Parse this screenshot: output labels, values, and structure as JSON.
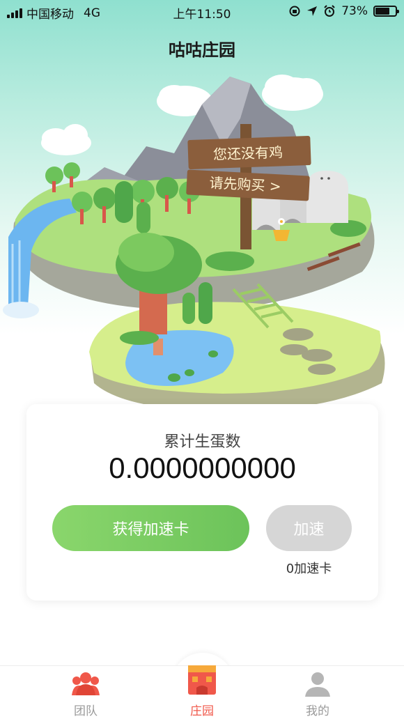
{
  "status_bar": {
    "carrier": "中国移动",
    "network": "4G",
    "time": "上午11:50",
    "battery": "73%",
    "battery_level": 0.73
  },
  "page": {
    "title": "咕咕庄园"
  },
  "scene": {
    "sign_line1": "您还没有鸡",
    "sign_line2": "请先购买 >"
  },
  "egg_card": {
    "label": "累计生蛋数",
    "value": "0.0000000000",
    "get_card_button": "获得加速卡",
    "speed_button": "加速",
    "speed_card_count": "0加速卡"
  },
  "tab_bar": {
    "tabs": [
      {
        "label": "团队",
        "icon": "team-icon",
        "active": false
      },
      {
        "label": "庄园",
        "icon": "manor-icon",
        "active": true
      },
      {
        "label": "我的",
        "icon": "profile-icon",
        "active": false
      }
    ]
  },
  "colors": {
    "accent_red": "#f0584a",
    "button_green": "#78cc60",
    "button_disabled": "#d6d6d6",
    "inactive_gray": "#9a9a9a"
  }
}
